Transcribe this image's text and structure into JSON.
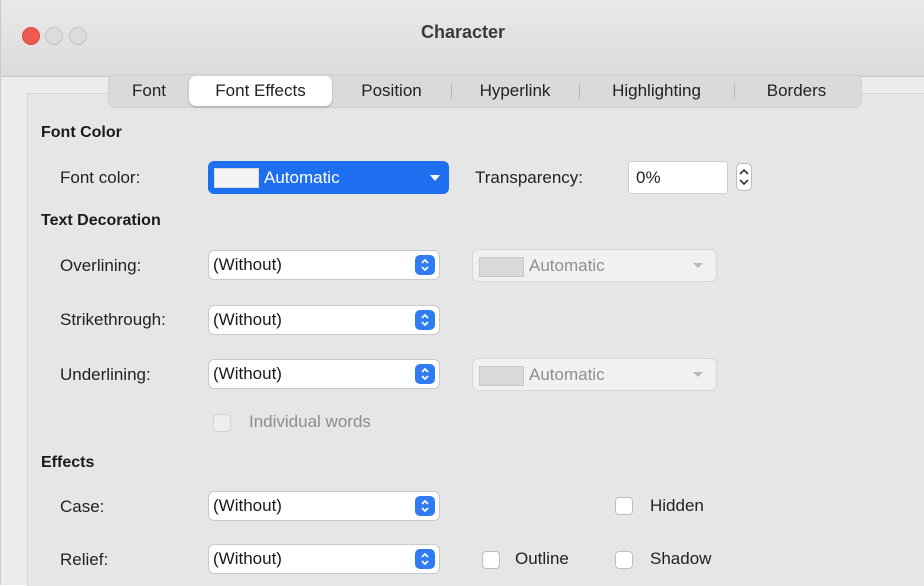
{
  "window": {
    "title": "Character"
  },
  "tabs": [
    {
      "label": "Font"
    },
    {
      "label": "Font Effects",
      "active": true
    },
    {
      "label": "Position"
    },
    {
      "label": "Hyperlink"
    },
    {
      "label": "Highlighting"
    },
    {
      "label": "Borders"
    }
  ],
  "font_color": {
    "heading": "Font Color",
    "label": "Font color:",
    "value": "Automatic",
    "transparency_label": "Transparency:",
    "transparency_value": "0%"
  },
  "text_decoration": {
    "heading": "Text Decoration",
    "overlining_label": "Overlining:",
    "overlining_value": "(Without)",
    "overline_color": "Automatic",
    "strikethrough_label": "Strikethrough:",
    "strikethrough_value": "(Without)",
    "underlining_label": "Underlining:",
    "underlining_value": "(Without)",
    "underline_color": "Automatic",
    "individual_words_label": "Individual words"
  },
  "effects": {
    "heading": "Effects",
    "case_label": "Case:",
    "case_value": "(Without)",
    "relief_label": "Relief:",
    "relief_value": "(Without)",
    "hidden_label": "Hidden",
    "outline_label": "Outline",
    "shadow_label": "Shadow"
  },
  "colors": {
    "accent": "#2f7bf2",
    "close": "#ee5a52"
  }
}
